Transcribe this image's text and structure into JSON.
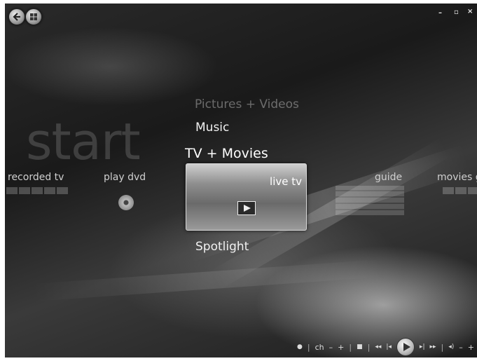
{
  "window": {
    "minimize_glyph": "–",
    "restore_glyph": "▫",
    "close_glyph": "×"
  },
  "nav": {
    "back_icon": "back-arrow-icon",
    "start_icon": "windows-logo-icon"
  },
  "start_label": "start",
  "menu": {
    "items": [
      "Pictures + Videos",
      "Music",
      "TV + Movies",
      "Spotlight"
    ],
    "selected": "TV + Movies"
  },
  "strip": {
    "items": [
      "recorded tv",
      "play dvd",
      "live tv",
      "guide",
      "movies g"
    ],
    "focused": "live tv"
  },
  "transport": {
    "record_glyph": "●",
    "ch_label": "ch",
    "minus_glyph": "–",
    "plus_glyph": "+",
    "stop_glyph": "■",
    "rewind_glyph": "◂◂",
    "prev_glyph": "|◂",
    "next_glyph": "▸|",
    "ffwd_glyph": "▸▸",
    "volume_glyph": "◂)",
    "vol_minus_glyph": "–",
    "vol_plus_glyph": "+"
  }
}
